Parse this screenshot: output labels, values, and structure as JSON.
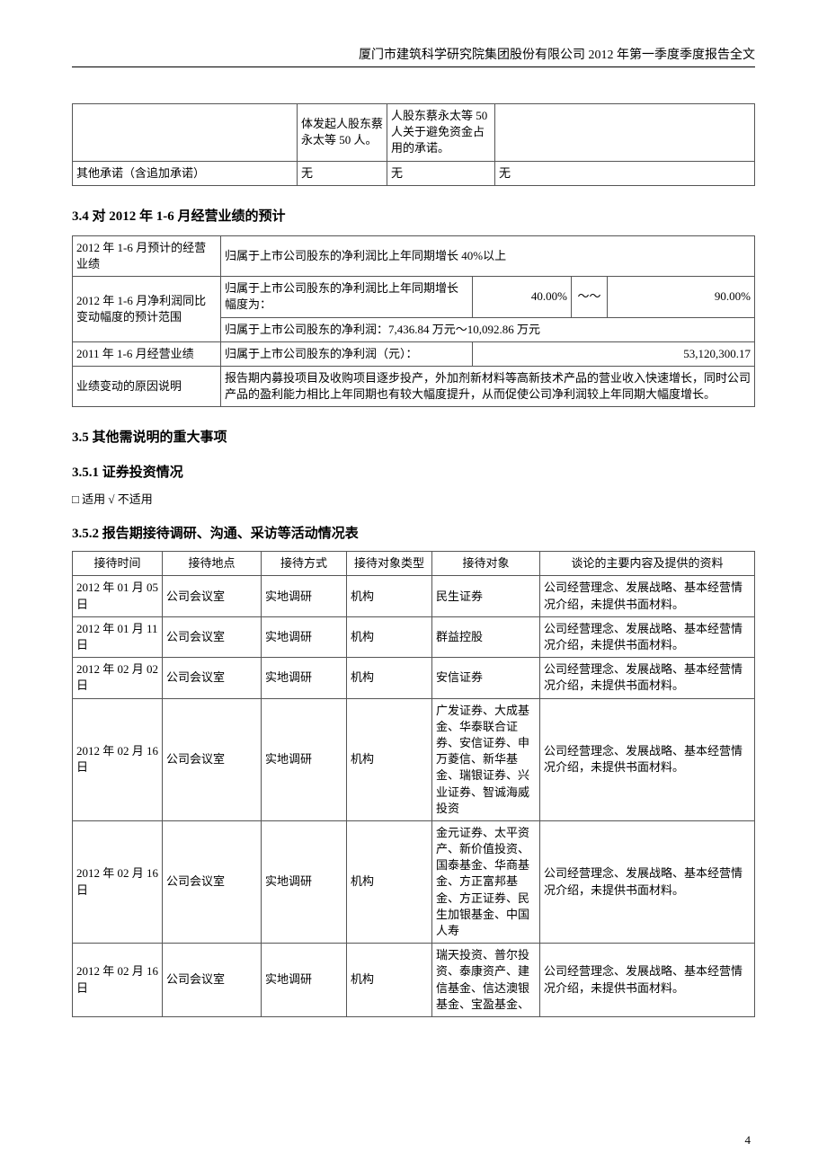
{
  "header": "厦门市建筑科学研究院集团股份有限公司 2012 年第一季度季度报告全文",
  "page_num": "4",
  "table1": {
    "r1c2": "体发起人股东蔡永太等 50 人。",
    "r1c3": "人股东蔡永太等 50 人关于避免资金占用的承诺。",
    "r2c1": "其他承诺（含追加承诺）",
    "r2c2": "无",
    "r2c3": "无",
    "r2c4": "无"
  },
  "sec34": "3.4 对 2012 年 1-6 月经营业绩的预计",
  "table2": {
    "r1c1": "2012 年 1-6 月预计的经营业绩",
    "r1c2": "归属于上市公司股东的净利润比上年同期增长 40%以上",
    "r2c1": "2012 年 1-6 月净利润同比变动幅度的预计范围",
    "r2c2a": "归属于上市公司股东的净利润比上年同期增长幅度为：",
    "r2c3": "40.00%",
    "r2c4": "～～",
    "r2c5": "90.00%",
    "r2c2b": "归属于上市公司股东的净利润：7,436.84 万元～10,092.86 万元",
    "r3c1": "2011 年 1-6 月经营业绩",
    "r3c2": "归属于上市公司股东的净利润（元）：",
    "r3c3": "53,120,300.17",
    "r4c1": "业绩变动的原因说明",
    "r4c2": "报告期内募投项目及收购项目逐步投产，外加剂新材料等高新技术产品的营业收入快速增长，同时公司产品的盈利能力相比上年同期也有较大幅度提升，从而促使公司净利润较上年同期大幅度增长。"
  },
  "sec35": "3.5 其他需说明的重大事项",
  "sec351": "3.5.1 证券投资情况",
  "note351": "□ 适用  √ 不适用",
  "sec352": "3.5.2 报告期接待调研、沟通、采访等活动情况表",
  "table3": {
    "headers": [
      "接待时间",
      "接待地点",
      "接待方式",
      "接待对象类型",
      "接待对象",
      "谈论的主要内容及提供的资料"
    ],
    "rows": [
      {
        "c1": "2012 年 01 月 05日",
        "c2": "公司会议室",
        "c3": "实地调研",
        "c4": "机构",
        "c5": "民生证券",
        "c6": "公司经营理念、发展战略、基本经营情况介绍，未提供书面材料。"
      },
      {
        "c1": "2012 年 01 月 11日",
        "c2": "公司会议室",
        "c3": "实地调研",
        "c4": "机构",
        "c5": "群益控股",
        "c6": "公司经营理念、发展战略、基本经营情况介绍，未提供书面材料。"
      },
      {
        "c1": "2012 年 02 月 02日",
        "c2": "公司会议室",
        "c3": "实地调研",
        "c4": "机构",
        "c5": "安信证券",
        "c6": "公司经营理念、发展战略、基本经营情况介绍，未提供书面材料。"
      },
      {
        "c1": "2012 年 02 月 16日",
        "c2": "公司会议室",
        "c3": "实地调研",
        "c4": "机构",
        "c5": "广发证券、大成基金、华泰联合证券、安信证券、申万菱信、新华基金、瑞银证券、兴业证券、智诚海威投资",
        "c6": "公司经营理念、发展战略、基本经营情况介绍，未提供书面材料。"
      },
      {
        "c1": "2012 年 02 月 16日",
        "c2": "公司会议室",
        "c3": "实地调研",
        "c4": "机构",
        "c5": "金元证券、太平资产、新价值投资、国泰基金、华商基金、方正富邦基金、方正证券、民生加银基金、中国人寿",
        "c6": "公司经营理念、发展战略、基本经营情况介绍，未提供书面材料。"
      },
      {
        "c1": "2012 年 02 月 16日",
        "c2": "公司会议室",
        "c3": "实地调研",
        "c4": "机构",
        "c5": "瑞天投资、普尔投资、泰康资产、建信基金、信达澳银基金、宝盈基金、",
        "c6": "公司经营理念、发展战略、基本经营情况介绍，未提供书面材料。"
      }
    ]
  }
}
